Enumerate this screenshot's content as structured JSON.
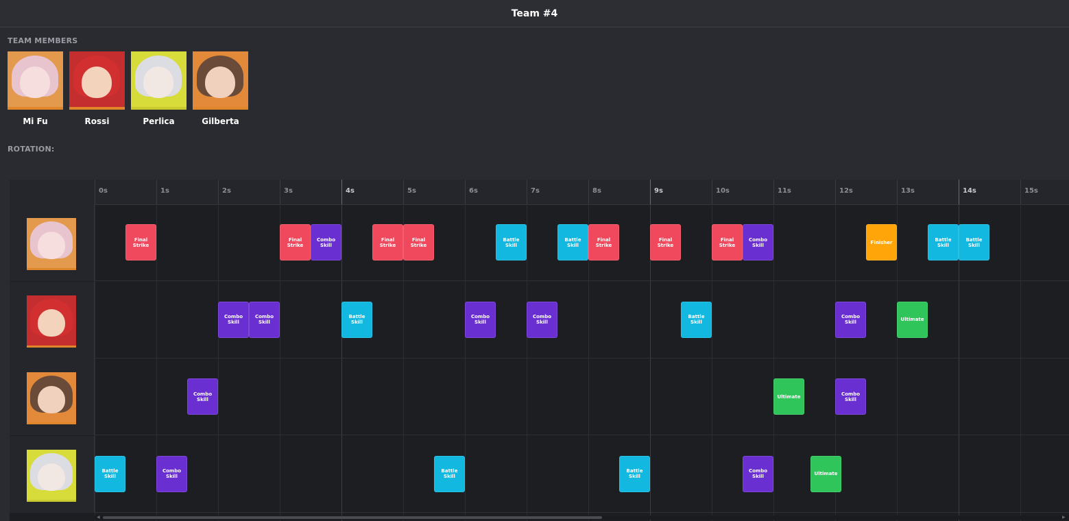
{
  "header": {
    "title": "Team #4"
  },
  "labels": {
    "team_members": "TEAM MEMBERS",
    "rotation": "ROTATION:"
  },
  "members": [
    {
      "name": "Mi Fu",
      "bg": "#e39a4d",
      "hair": "#e8c4cf",
      "face": "#f6dede",
      "accent": "#e0862a"
    },
    {
      "name": "Rossi",
      "bg": "#c42e2e",
      "hair": "#d23030",
      "face": "#f4d3bd",
      "accent": "#e0862a"
    },
    {
      "name": "Perlica",
      "bg": "#d8dc3a",
      "hair": "#dcdde2",
      "face": "#f1e7e3",
      "accent": "#c8c92e"
    },
    {
      "name": "Gilberta",
      "bg": "#e28a3a",
      "hair": "#6a4b3a",
      "face": "#f0d1bd",
      "accent": "#e0862a"
    }
  ],
  "timeline": {
    "ticks": [
      "0s",
      "1s",
      "2s",
      "3s",
      "4s",
      "5s",
      "6s",
      "7s",
      "8s",
      "9s",
      "10s",
      "11s",
      "12s",
      "13s",
      "14s",
      "15s"
    ],
    "major_ticks": [
      "4s",
      "9s",
      "14s"
    ]
  },
  "action_colors": {
    "Final Strike": "#f0495e",
    "Combo Skill": "#6a2fd0",
    "Battle Skill": "#12b8e0",
    "Ultimate": "#2fc55a",
    "Finisher": "#ffa50a"
  },
  "rows": [
    {
      "member": "Mi Fu",
      "bg": "#e39a4d",
      "hair": "#e8c4cf",
      "face": "#f6dede",
      "accent": "#e0862a",
      "actions": [
        {
          "t": 0.5,
          "label": "Final Strike",
          "type": "Final Strike"
        },
        {
          "t": 3.0,
          "label": "Final Strike",
          "type": "Final Strike"
        },
        {
          "t": 3.5,
          "label": "Combo Skill",
          "type": "Combo Skill"
        },
        {
          "t": 4.5,
          "label": "Final Strike",
          "type": "Final Strike"
        },
        {
          "t": 5.0,
          "label": "Final Strike",
          "type": "Final Strike"
        },
        {
          "t": 6.5,
          "label": "Battle Skill",
          "type": "Battle Skill"
        },
        {
          "t": 7.5,
          "label": "Battle Skill",
          "type": "Battle Skill"
        },
        {
          "t": 8.0,
          "label": "Final Strike",
          "type": "Final Strike"
        },
        {
          "t": 9.0,
          "label": "Final Strike",
          "type": "Final Strike"
        },
        {
          "t": 10.0,
          "label": "Final Strike",
          "type": "Final Strike"
        },
        {
          "t": 10.5,
          "label": "Combo Skill",
          "type": "Combo Skill"
        },
        {
          "t": 12.5,
          "label": "Finisher",
          "type": "Finisher"
        },
        {
          "t": 13.5,
          "label": "Battle Skill",
          "type": "Battle Skill"
        },
        {
          "t": 14.0,
          "label": "Battle Skill",
          "type": "Battle Skill"
        }
      ]
    },
    {
      "member": "Rossi",
      "bg": "#c42e2e",
      "hair": "#d23030",
      "face": "#f4d3bd",
      "accent": "#e0862a",
      "actions": [
        {
          "t": 2.0,
          "label": "Combo Skill",
          "type": "Combo Skill"
        },
        {
          "t": 2.5,
          "label": "Combo Skill",
          "type": "Combo Skill"
        },
        {
          "t": 4.0,
          "label": "Battle Skill",
          "type": "Battle Skill"
        },
        {
          "t": 6.0,
          "label": "Combo Skill",
          "type": "Combo Skill"
        },
        {
          "t": 7.0,
          "label": "Combo Skill",
          "type": "Combo Skill"
        },
        {
          "t": 9.5,
          "label": "Battle Skill",
          "type": "Battle Skill"
        },
        {
          "t": 12.0,
          "label": "Combo Skill",
          "type": "Combo Skill"
        },
        {
          "t": 13.0,
          "label": "Ultimate",
          "type": "Ultimate"
        }
      ]
    },
    {
      "member": "Gilberta",
      "bg": "#e28a3a",
      "hair": "#6a4b3a",
      "face": "#f0d1bd",
      "accent": "#e0862a",
      "actions": [
        {
          "t": 1.5,
          "label": "Combo Skill",
          "type": "Combo Skill"
        },
        {
          "t": 11.0,
          "label": "Ultimate",
          "type": "Ultimate"
        },
        {
          "t": 12.0,
          "label": "Combo Skill",
          "type": "Combo Skill"
        }
      ]
    },
    {
      "member": "Perlica",
      "bg": "#d8dc3a",
      "hair": "#dcdde2",
      "face": "#f1e7e3",
      "accent": "#c8c92e",
      "actions": [
        {
          "t": 0.0,
          "label": "Battle Skill",
          "type": "Battle Skill"
        },
        {
          "t": 1.0,
          "label": "Combo Skill",
          "type": "Combo Skill"
        },
        {
          "t": 5.5,
          "label": "Battle Skill",
          "type": "Battle Skill"
        },
        {
          "t": 8.5,
          "label": "Battle Skill",
          "type": "Battle Skill"
        },
        {
          "t": 10.5,
          "label": "Combo Skill",
          "type": "Combo Skill"
        },
        {
          "t": 11.6,
          "label": "Ultimate",
          "type": "Ultimate"
        }
      ]
    }
  ]
}
